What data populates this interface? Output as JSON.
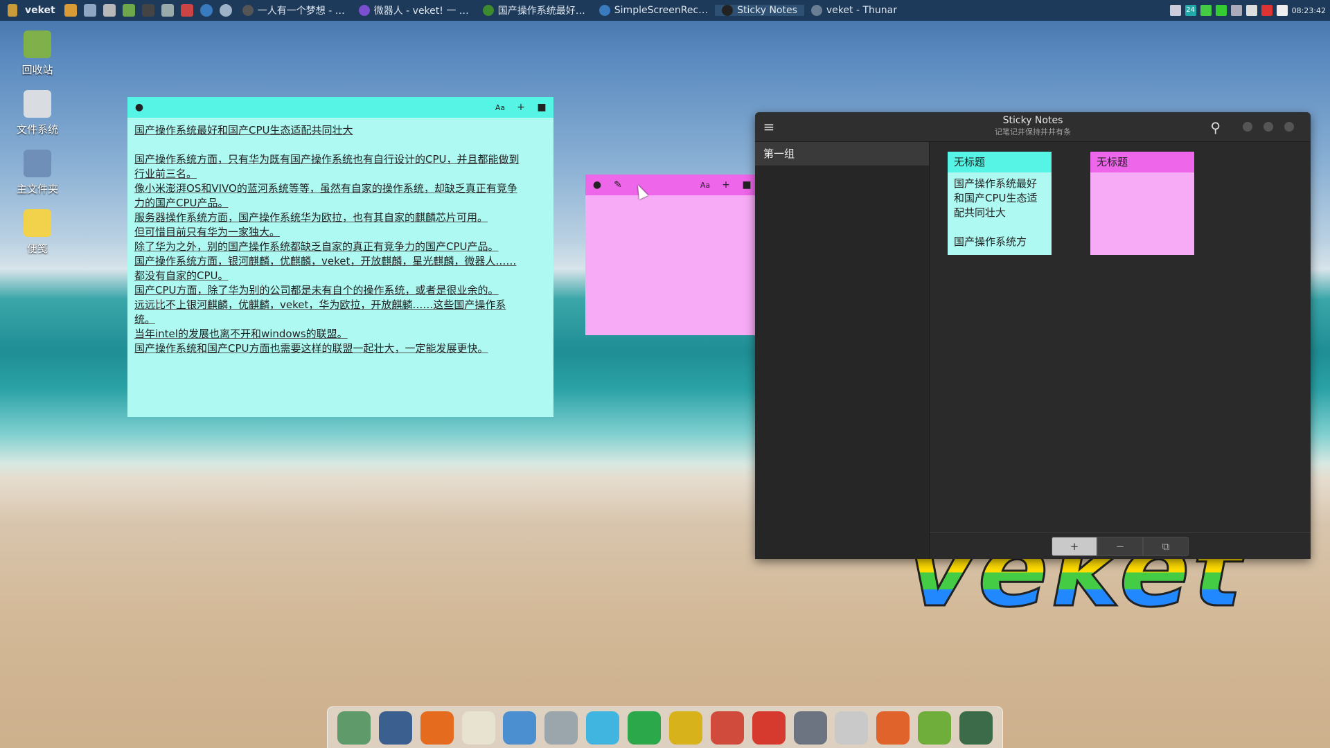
{
  "top_panel": {
    "brand": "veket",
    "tasks": [
      {
        "label": "一人有一个梦想 - …",
        "color": "#555555"
      },
      {
        "label": "微器人 - veket! 一 …",
        "color": "#7a4fd0"
      },
      {
        "label": "国产操作系统最好…",
        "color": "#3e8a2e"
      },
      {
        "label": "SimpleScreenRec…",
        "color": "#3a7abf"
      },
      {
        "label": "Sticky Notes",
        "color": "#222222"
      },
      {
        "label": "veket - Thunar",
        "color": "#6a7f94"
      }
    ],
    "battery_badge": "24",
    "clock": "08:23:42"
  },
  "desktop_icons": [
    {
      "label": "回收站",
      "icon": "recycle-bin-icon",
      "color": "#7fb04a"
    },
    {
      "label": "文件系统",
      "icon": "drive-icon",
      "color": "#d9dde2"
    },
    {
      "label": "主文件夹",
      "icon": "home-folder-icon",
      "color": "#6f8fb8"
    },
    {
      "label": "便笺",
      "icon": "sticky-note-icon",
      "color": "#f2d24b"
    }
  ],
  "note_cyan": {
    "lines": [
      "国产操作系统最好和国产CPU生态适配共同壮大",
      "",
      "国产操作系统方面，只有华为既有国产操作系统也有自行设计的CPU，并且都能做到",
      "行业前三名。",
      "像小米澎湃OS和VIVO的蓝河系统等等，虽然有自家的操作系统，却缺乏真正有竞争",
      "力的国产CPU产品。",
      "服务器操作系统方面，国产操作系统华为欧拉，也有其自家的麒麟芯片可用。",
      "但可惜目前只有华为一家独大。",
      "除了华为之外，别的国产操作系统都缺乏自家的真正有竞争力的国产CPU产品。",
      "国产操作系统方面，银河麒麟，优麒麟，veket，开放麒麟，星光麒麟，微器人……",
      "都没有自家的CPU。",
      "国产CPU方面，除了华为别的公司都是未有自个的操作系统，或者是很业余的。",
      "远远比不上银河麒麟，优麒麟，veket，华为欧拉，开放麒麟……这些国产操作系",
      "统。",
      "当年intel的发展也离不开和windows的联盟。",
      "国产操作系统和国产CPU方面也需要这样的联盟一起壮大，一定能发展更快。"
    ]
  },
  "toolbar_glyphs": {
    "color": "●",
    "edit": "✎",
    "font": "Aa",
    "add": "+",
    "delete": "■"
  },
  "app": {
    "title": "Sticky Notes",
    "subtitle": "记笔记井保持井井有条",
    "group": "第一组",
    "cards": [
      {
        "title": "无标题",
        "body": [
          "国产操作系统最好",
          "和国产CPU生态适",
          "配共同壮大",
          "",
          "国产操作系统方"
        ]
      },
      {
        "title": "无标题",
        "body": []
      }
    ],
    "footer_buttons": [
      "+",
      "−",
      "⧉"
    ]
  },
  "logo_text": "veket",
  "dock": [
    {
      "icon": "file-manager-icon",
      "color": "#5e9a6a"
    },
    {
      "icon": "computer-icon",
      "color": "#3b5f8f"
    },
    {
      "icon": "browser-icon",
      "color": "#e56b1f"
    },
    {
      "icon": "text-editor-icon",
      "color": "#e8e2d0"
    },
    {
      "icon": "image-viewer-icon",
      "color": "#4c8fd0"
    },
    {
      "icon": "music-icon",
      "color": "#9aa6ac"
    },
    {
      "icon": "atom-icon",
      "color": "#3fb5e0"
    },
    {
      "icon": "media-player-icon",
      "color": "#2aa84a"
    },
    {
      "icon": "terminal-icon",
      "color": "#d8b21a"
    },
    {
      "icon": "chart-icon",
      "color": "#d14b3c"
    },
    {
      "icon": "rocket-icon",
      "color": "#d63a2f"
    },
    {
      "icon": "network-icon",
      "color": "#6b7480"
    },
    {
      "icon": "settings-icon",
      "color": "#c9c9c9"
    },
    {
      "icon": "firefox-icon",
      "color": "#e0632c"
    },
    {
      "icon": "notes-icon",
      "color": "#6fae3a"
    },
    {
      "icon": "globe-icon",
      "color": "#3c6b4a"
    }
  ]
}
